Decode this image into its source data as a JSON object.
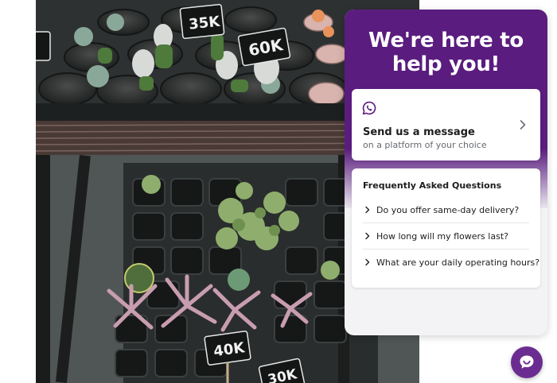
{
  "widget": {
    "title_line1": "We're here to",
    "title_line2": "help you!",
    "message_card": {
      "title": "Send us a message",
      "subtitle": "on a platform of your choice",
      "icon": "whatsapp-icon"
    },
    "faq": {
      "heading": "Frequently Asked Questions",
      "items": [
        {
          "question": "Do you offer same-day delivery?"
        },
        {
          "question": "How long will my flowers last?"
        },
        {
          "question": "What are your daily operating hours?"
        }
      ]
    },
    "launcher_icon": "chat-smile-icon"
  },
  "photo": {
    "tags": [
      "35K",
      "60K",
      "40K",
      "30K"
    ]
  },
  "colors": {
    "brand_purple": "#5a1c7e",
    "launcher_purple": "#6b2c91",
    "panel_bg": "#f3f3f5"
  }
}
